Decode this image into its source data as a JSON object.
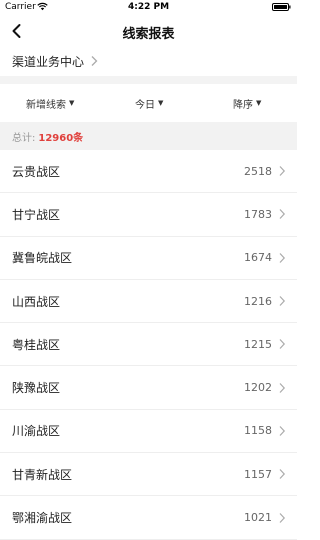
{
  "status_bar": {
    "carrier": "Carrier",
    "time": "4:22 PM"
  },
  "nav": {
    "title": "线索报表"
  },
  "channel": {
    "label": "渠道业务中心"
  },
  "filters": [
    {
      "label": "新增线索"
    },
    {
      "label": "今日"
    },
    {
      "label": "降序"
    }
  ],
  "summary": {
    "total_label": "总计:",
    "total_value": "12960条"
  },
  "regions": [
    {
      "name": "云贵战区",
      "count": "2518"
    },
    {
      "name": "甘宁战区",
      "count": "1783"
    },
    {
      "name": "冀鲁皖战区",
      "count": "1674"
    },
    {
      "name": "山西战区",
      "count": "1216"
    },
    {
      "name": "粤桂战区",
      "count": "1215"
    },
    {
      "name": "陕豫战区",
      "count": "1202"
    },
    {
      "name": "川渝战区",
      "count": "1158"
    },
    {
      "name": "甘青新战区",
      "count": "1157"
    },
    {
      "name": "鄂湘渝战区",
      "count": "1021"
    }
  ],
  "colors": {
    "total_value": "#e0403c",
    "section_bg": "#f2f2f2"
  }
}
